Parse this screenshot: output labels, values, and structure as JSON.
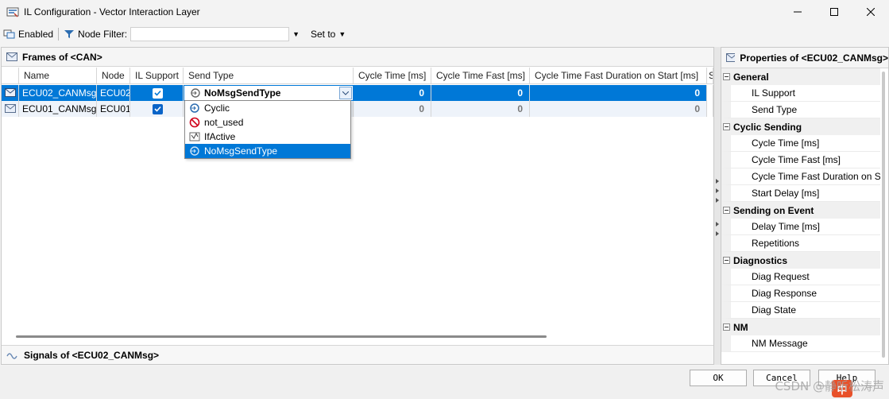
{
  "window": {
    "title": "IL Configuration - Vector Interaction Layer"
  },
  "toolbar": {
    "enabled_label": "Enabled",
    "node_filter_label": "Node Filter:",
    "node_filter_value": "",
    "set_to_label": "Set to"
  },
  "frames_panel": {
    "title": "Frames of <CAN>",
    "columns": [
      "Name",
      "Node",
      "IL Support",
      "Send Type",
      "Cycle Time [ms]",
      "Cycle Time Fast [ms]",
      "Cycle Time Fast Duration on Start [ms]",
      "S"
    ],
    "rows": [
      {
        "name": "ECU02_CANMsg",
        "node": "ECU02",
        "il_support": true,
        "send_type": "NoMsgSendType",
        "cycle_time": "0",
        "cycle_time_fast": "0",
        "cycle_time_fast_duration": "0",
        "selected": true
      },
      {
        "name": "ECU01_CANMsg",
        "node": "ECU01",
        "il_support": true,
        "send_type": "",
        "cycle_time": "0",
        "cycle_time_fast": "0",
        "cycle_time_fast_duration": "0",
        "selected": false
      }
    ],
    "send_type_options": [
      {
        "label": "Cyclic",
        "icon": "cyclic-icon"
      },
      {
        "label": "not_used",
        "icon": "not-used-icon"
      },
      {
        "label": "IfActive",
        "icon": "if-active-icon"
      },
      {
        "label": "NoMsgSendType",
        "icon": "no-msg-send-type-icon",
        "selected": true
      }
    ]
  },
  "signals_panel": {
    "title": "Signals of <ECU02_CANMsg>"
  },
  "properties_panel": {
    "title": "Properties of <ECU02_CANMsg>",
    "categories": [
      {
        "name": "General",
        "items": [
          "IL Support",
          "Send Type"
        ]
      },
      {
        "name": "Cyclic Sending",
        "items": [
          "Cycle Time [ms]",
          "Cycle Time Fast [ms]",
          "Cycle Time Fast Duration on S",
          "Start Delay [ms]"
        ]
      },
      {
        "name": "Sending on Event",
        "items": [
          "Delay Time [ms]",
          "Repetitions"
        ]
      },
      {
        "name": "Diagnostics",
        "items": [
          "Diag Request",
          "Diag Response",
          "Diag State"
        ]
      },
      {
        "name": "NM",
        "items": [
          "NM Message"
        ]
      }
    ]
  },
  "buttons": {
    "ok": "OK",
    "cancel": "Cancel",
    "help": "Help"
  },
  "overlay": {
    "watermark": "CSDN @静听松涛声",
    "ime_label": "中"
  },
  "colors": {
    "selection": "#0078d7",
    "checkbox": "#0a64c8"
  }
}
